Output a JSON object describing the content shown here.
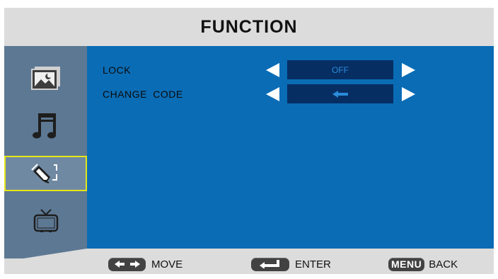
{
  "header": {
    "title": "FUNCTION"
  },
  "sidebar": {
    "items": [
      {
        "name": "picture",
        "icon": "picture-icon",
        "selected": false
      },
      {
        "name": "sound",
        "icon": "music-note-icon",
        "selected": false
      },
      {
        "name": "function",
        "icon": "function-tools-icon",
        "selected": true
      },
      {
        "name": "tv",
        "icon": "tv-icon",
        "selected": false
      }
    ]
  },
  "settings": {
    "rows": [
      {
        "label": "LOCK",
        "value": "OFF"
      },
      {
        "label": "CHANGE  CODE",
        "value": "←",
        "value_icon": "left-arrow-icon"
      }
    ]
  },
  "footer": {
    "move": {
      "key_icon": "left-right-arrows-icon",
      "label": "MOVE"
    },
    "enter": {
      "key_icon": "enter-key-icon",
      "label": "ENTER"
    },
    "back": {
      "key_label": "MENU",
      "label": "BACK"
    }
  },
  "colors": {
    "panel": "#0a6cb5",
    "value_box": "#062e63",
    "value_text": "#2b8bd9",
    "sidebar": "#5d7893",
    "selection_border": "#e6e619",
    "background": "#dcdcdc"
  }
}
